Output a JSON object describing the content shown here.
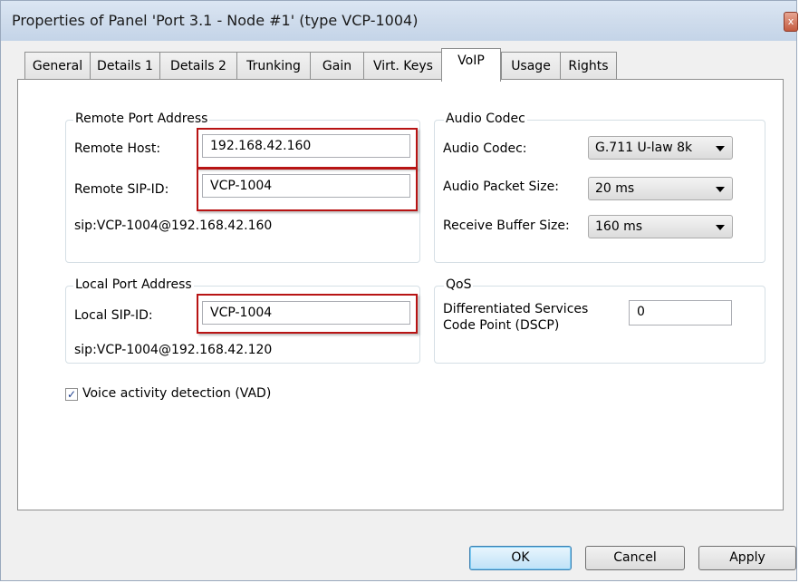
{
  "window": {
    "title": "Properties of Panel 'Port 3.1 - Node #1' (type VCP-1004)",
    "close_glyph": "x"
  },
  "tabs": [
    {
      "label": "General"
    },
    {
      "label": "Details 1"
    },
    {
      "label": "Details 2"
    },
    {
      "label": "Trunking"
    },
    {
      "label": "Gain"
    },
    {
      "label": "Virt. Keys"
    },
    {
      "label": "VoIP"
    },
    {
      "label": "Usage"
    },
    {
      "label": "Rights"
    }
  ],
  "active_tab": "VoIP",
  "remote": {
    "group_title": "Remote Port Address",
    "host_label": "Remote Host:",
    "host_value": "192.168.42.160",
    "sip_label": "Remote SIP-ID:",
    "sip_value": "VCP-1004",
    "uri": "sip:VCP-1004@192.168.42.160"
  },
  "local": {
    "group_title": "Local Port Address",
    "sip_label": "Local SIP-ID:",
    "sip_value": "VCP-1004",
    "uri": "sip:VCP-1004@192.168.42.120"
  },
  "audio": {
    "group_title": "Audio Codec",
    "codec_label": "Audio Codec:",
    "codec_value": "G.711 U-law 8k",
    "packet_label": "Audio Packet Size:",
    "packet_value": "20 ms",
    "buffer_label": "Receive Buffer Size:",
    "buffer_value": "160 ms"
  },
  "qos": {
    "group_title": "QoS",
    "dscp_label_line1": "Differentiated Services",
    "dscp_label_line2": "Code Point (DSCP)",
    "dscp_value": "0"
  },
  "vad": {
    "label": "Voice activity detection (VAD)",
    "checked": true,
    "check_glyph": "✓"
  },
  "buttons": {
    "ok": "OK",
    "cancel": "Cancel",
    "apply": "Apply"
  },
  "colors": {
    "highlight_box": "#b81414",
    "titlebar": "#cfdcec"
  }
}
